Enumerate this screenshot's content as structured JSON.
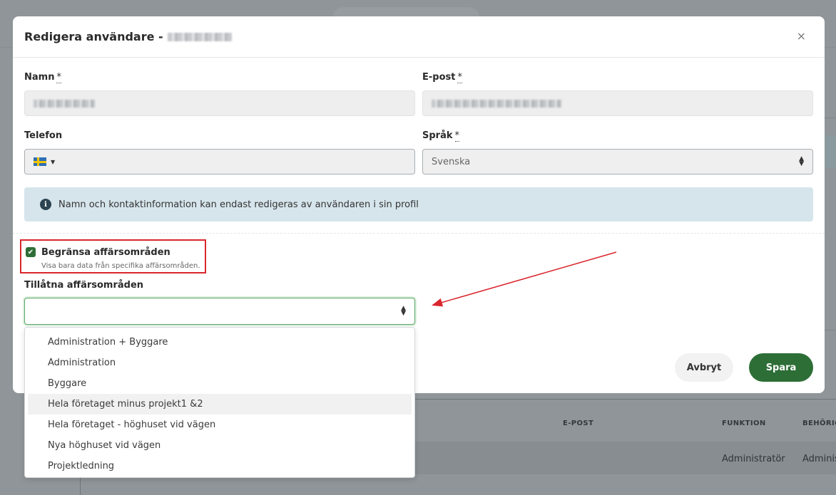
{
  "modal": {
    "title": "Redigera användare -",
    "close_glyph": "×",
    "fields": {
      "name_label": "Namn",
      "email_label": "E-post",
      "phone_label": "Telefon",
      "language_label": "Språk",
      "required_mark": "*",
      "language_value": "Svenska"
    },
    "info_text": "Namn och kontaktinformation kan endast redigeras av användaren i sin profil",
    "restrict": {
      "label": "Begränsa affärsområden",
      "help": "Visa bara data från specifika affärsområden.",
      "checked": true
    },
    "allowed_label": "Tillåtna affärsområden",
    "dropdown_options": [
      "Administration + Byggare",
      "Administration",
      "Byggare",
      "Hela företaget minus projekt1 &2",
      "Hela företaget - höghuset vid vägen",
      "Nya höghuset vid vägen",
      "Projektledning"
    ],
    "hovered_option_index": 3,
    "buttons": {
      "cancel": "Avbryt",
      "save": "Spara"
    }
  },
  "background": {
    "headers": {
      "email": "E-POST",
      "function": "FUNKTION",
      "permission": "BEHÖRIG"
    },
    "row": {
      "function": "Administratör",
      "permission": "Adminis"
    }
  },
  "colors": {
    "primary_green": "#2d6e36",
    "info_bg": "#d6e5ec",
    "highlight_red": "#d9262c"
  },
  "icons": {
    "close": "close-icon",
    "info": "info-icon",
    "flag": "swedish-flag-icon",
    "check": "checkmark-icon",
    "select_arrows": "sort-arrows-icon"
  }
}
